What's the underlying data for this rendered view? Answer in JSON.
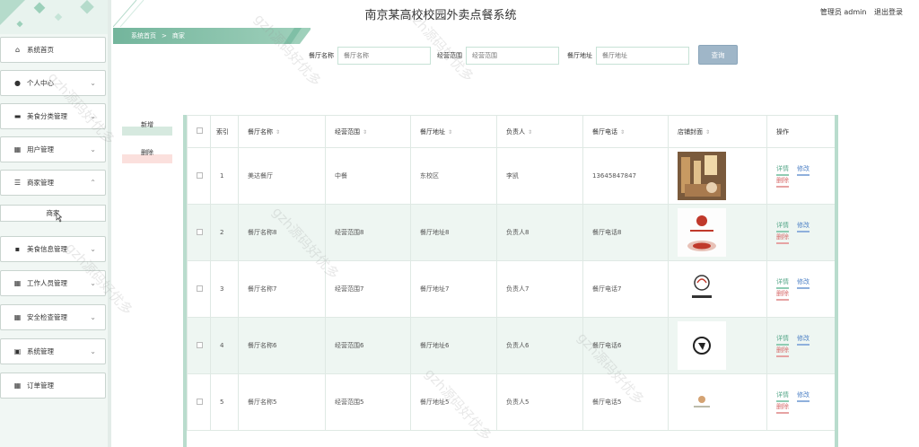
{
  "header": {
    "title": "南京某高校校园外卖点餐系统",
    "user_role": "管理员 admin",
    "logout": "退出登录"
  },
  "breadcrumb": {
    "home": "系统首页",
    "sep": ">",
    "current": "商家"
  },
  "sidebar": {
    "items": [
      {
        "label": "系统首页",
        "icon": "home-icon"
      },
      {
        "label": "个人中心",
        "icon": "user-icon"
      },
      {
        "label": "美食分类管理",
        "icon": "ticket-icon"
      },
      {
        "label": "用户管理",
        "icon": "grid-icon"
      },
      {
        "label": "商家管理",
        "icon": "sliders-icon"
      },
      {
        "label": "美食信息管理",
        "icon": "chat-icon"
      },
      {
        "label": "工作人员管理",
        "icon": "grid-icon"
      },
      {
        "label": "安全检查管理",
        "icon": "grid-icon"
      },
      {
        "label": "系统管理",
        "icon": "briefcase-icon"
      },
      {
        "label": "订单管理",
        "icon": "grid-icon"
      }
    ],
    "submenu_label": "商家"
  },
  "search": {
    "name_label": "餐厅名称",
    "name_placeholder": "餐厅名称",
    "scope_label": "经营范围",
    "scope_placeholder": "经营范围",
    "addr_label": "餐厅地址",
    "addr_placeholder": "餐厅地址",
    "button": "查询"
  },
  "actions": {
    "add": "新增",
    "delete": "删除"
  },
  "table": {
    "headers": [
      "索引",
      "餐厅名称",
      "经营范围",
      "餐厅地址",
      "负责人",
      "餐厅电话",
      "店铺封面",
      "操作"
    ],
    "ops": {
      "detail": "详情",
      "edit": "修改",
      "delete": "删除"
    },
    "rows": [
      {
        "idx": "1",
        "name": "美达餐厅",
        "scope": "中餐",
        "addr": "东校区",
        "owner": "李凯",
        "phone": "13645847847"
      },
      {
        "idx": "2",
        "name": "餐厅名称8",
        "scope": "经营范围8",
        "addr": "餐厅地址8",
        "owner": "负责人8",
        "phone": "餐厅电话8"
      },
      {
        "idx": "3",
        "name": "餐厅名称7",
        "scope": "经营范围7",
        "addr": "餐厅地址7",
        "owner": "负责人7",
        "phone": "餐厅电话7"
      },
      {
        "idx": "4",
        "name": "餐厅名称6",
        "scope": "经营范围6",
        "addr": "餐厅地址6",
        "owner": "负责人6",
        "phone": "餐厅电话6"
      },
      {
        "idx": "5",
        "name": "餐厅名称5",
        "scope": "经营范围5",
        "addr": "餐厅地址5",
        "owner": "负责人5",
        "phone": "餐厅电话5"
      }
    ]
  },
  "watermark": "gzh源码好优多",
  "colors": {
    "accent": "#73b59c",
    "row_alt": "#eef6f2",
    "query_button": "#9fb6c8"
  }
}
